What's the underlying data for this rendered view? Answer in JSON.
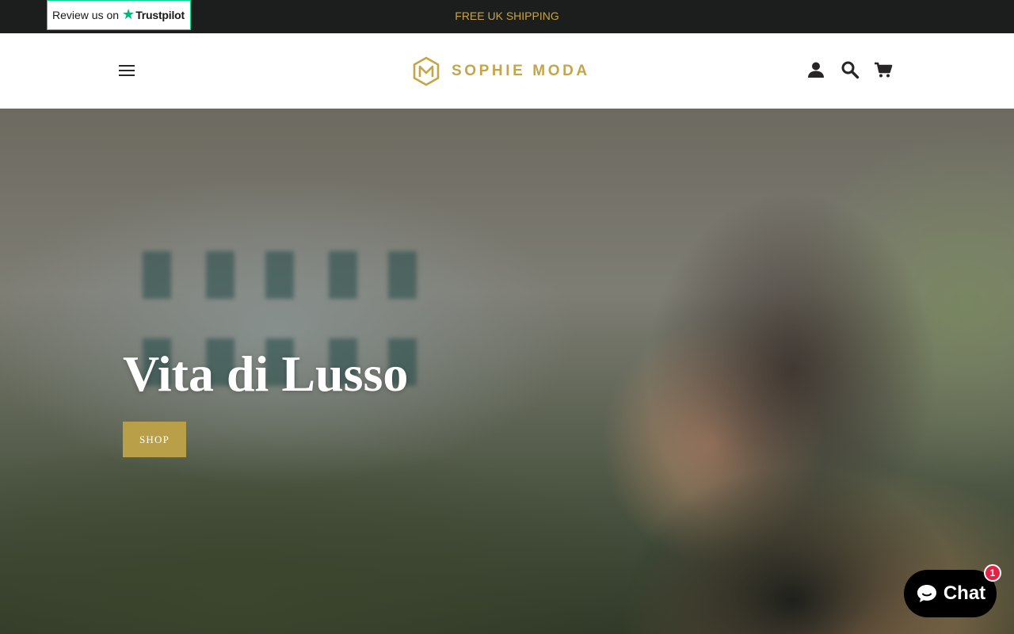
{
  "announcement": {
    "trustpilot": {
      "prefix": "Review us on",
      "brand": "Trustpilot",
      "star_icon": "star-icon"
    },
    "text": "FREE UK SHIPPING",
    "text_color": "#c4a548",
    "background": "#1c1d1d"
  },
  "header": {
    "menu_icon": "hamburger-menu-icon",
    "logo": {
      "text": "SOPHIE MODA",
      "color": "#c4a548"
    },
    "icons": [
      "account-icon",
      "search-icon",
      "cart-icon"
    ]
  },
  "hero": {
    "title": "Vita di Lusso",
    "cta_label": "SHOP",
    "cta_color": "#b9a048"
  },
  "chat": {
    "label": "Chat",
    "badge_count": "1",
    "badge_color": "#e42245"
  }
}
